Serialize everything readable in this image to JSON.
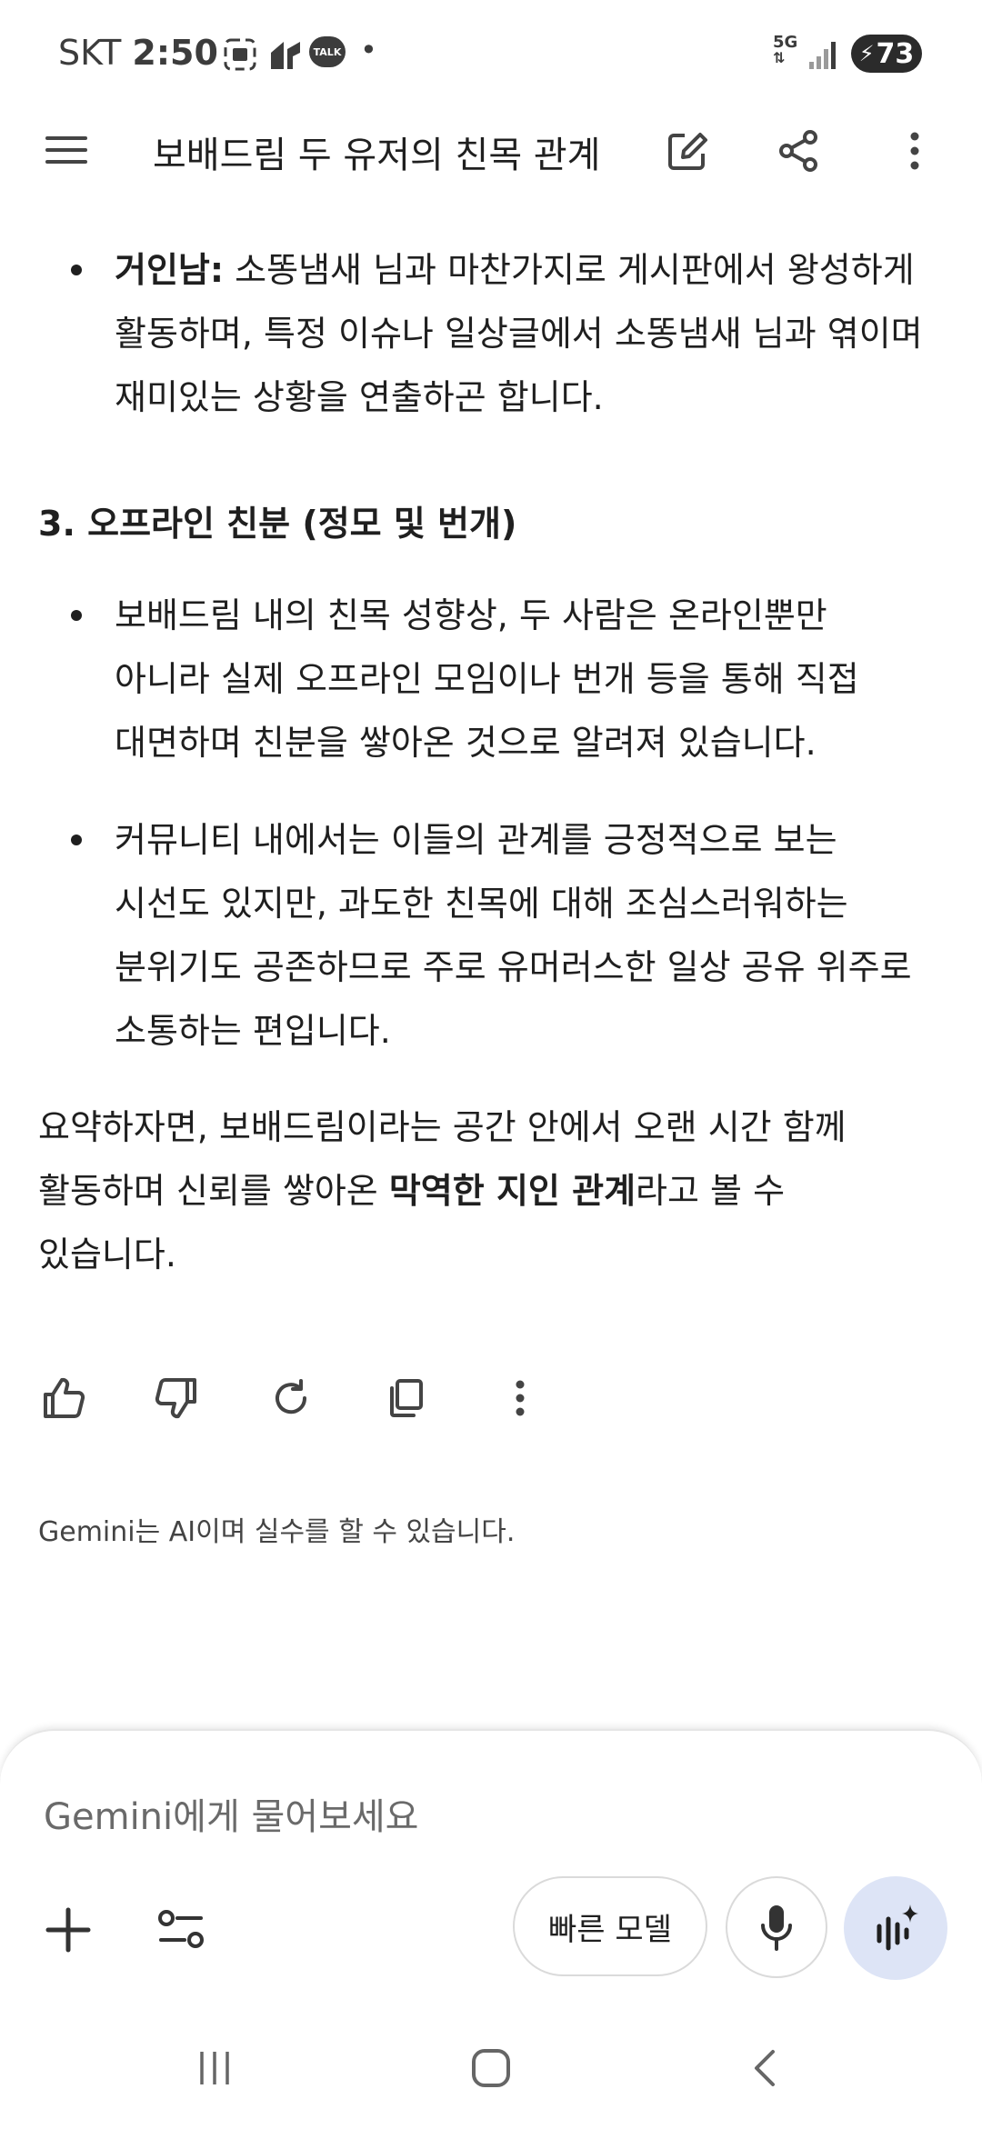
{
  "status_bar": {
    "carrier": "SKT",
    "time": "2:50",
    "battery": "73",
    "network": "5G",
    "talk_badge": "TALK",
    "dot": "•"
  },
  "app_bar": {
    "title": "보배드림 두 유저의 친목 관계"
  },
  "content": {
    "bullet_top": {
      "bold": "거인남:",
      "line1": " 소똥냄새 님과 마찬가지로 게시판에서 왕성하게",
      "line2": "활동하며, 특정 이슈나 일상글에서 소똥냄새 님과 엮이며",
      "line3": "재미있는 상황을 연출하곤 합니다."
    },
    "section3_heading": "3. 오프라인 친분 (정모 및 번개)",
    "bullet1": {
      "line1": "보배드림 내의 친목 성향상, 두 사람은 온라인뿐만",
      "line2": "아니라 실제 오프라인 모임이나 번개 등을 통해 직접",
      "line3": "대면하며 친분을 쌓아온 것으로 알려져 있습니다."
    },
    "bullet2": {
      "line1": "커뮤니티 내에서는 이들의 관계를 긍정적으로 보는",
      "line2": "시선도 있지만, 과도한 친목에 대해 조심스러워하는",
      "line3": "분위기도 공존하므로 주로 유머러스한 일상 공유 위주로",
      "line4": "소통하는 편입니다."
    },
    "summary": {
      "line1": "요약하자면, 보배드림이라는 공간 안에서 오랜 시간 함께",
      "line2_pre": "활동하며 신뢰를 쌓아온 ",
      "line2_bold": "막역한 지인 관계",
      "line2_post": "라고 볼 수",
      "line3": "있습니다."
    }
  },
  "disclaimer": "Gemini는 AI이며 실수를 할 수 있습니다.",
  "input": {
    "placeholder": "Gemini에게 물어보세요",
    "model_button": "빠른 모델"
  },
  "colors": {
    "text": "#1f1f1f",
    "live_button_bg": "#dde4f6",
    "battery_bg": "#2b2b2b"
  }
}
